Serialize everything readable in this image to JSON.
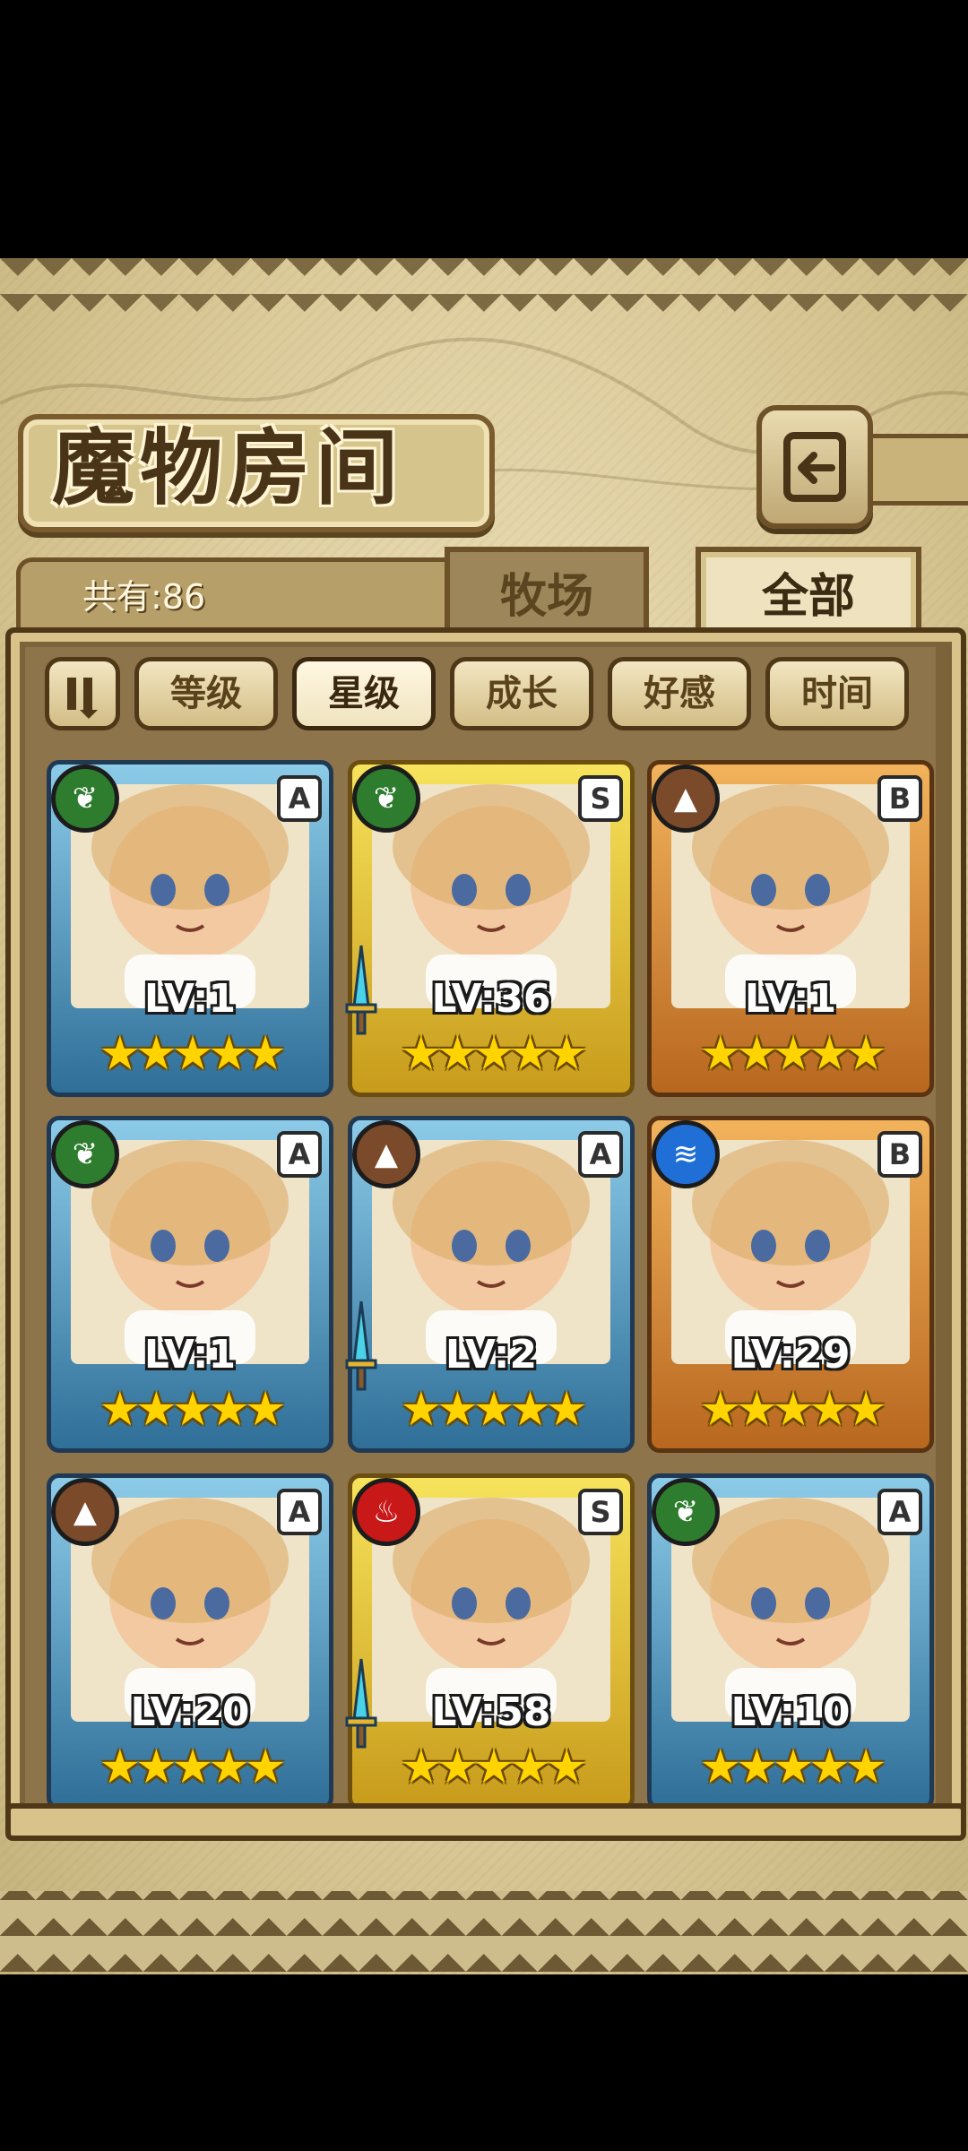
{
  "header": {
    "title": "魔物房间"
  },
  "summary": {
    "count_label": "共有:86"
  },
  "tabs": [
    {
      "label": "牧场",
      "active": false
    },
    {
      "label": "全部",
      "active": true
    }
  ],
  "sort": {
    "buttons": [
      {
        "label": "等级",
        "active": false
      },
      {
        "label": "星级",
        "active": true
      },
      {
        "label": "成长",
        "active": false
      },
      {
        "label": "好感",
        "active": false
      },
      {
        "label": "时间",
        "active": false
      }
    ]
  },
  "monsters": [
    {
      "level": "LV:1",
      "grade": "A",
      "element": "leaf",
      "stars": "★★★★★",
      "frame": "blue",
      "weapon": false
    },
    {
      "level": "LV:36",
      "grade": "S",
      "element": "leaf",
      "stars": "★★★★★",
      "frame": "gold",
      "weapon": true
    },
    {
      "level": "LV:1",
      "grade": "B",
      "element": "earth",
      "stars": "★★★★★",
      "frame": "orange",
      "weapon": false
    },
    {
      "level": "LV:1",
      "grade": "A",
      "element": "leaf",
      "stars": "★★★★★",
      "frame": "blue",
      "weapon": false
    },
    {
      "level": "LV:2",
      "grade": "A",
      "element": "earth",
      "stars": "★★★★★",
      "frame": "blue",
      "weapon": true
    },
    {
      "level": "LV:29",
      "grade": "B",
      "element": "water",
      "stars": "★★★★★",
      "frame": "orange",
      "weapon": false
    },
    {
      "level": "LV:20",
      "grade": "A",
      "element": "earth",
      "stars": "★★★★★",
      "frame": "blue",
      "weapon": false
    },
    {
      "level": "LV:58",
      "grade": "S",
      "element": "fire",
      "stars": "★★★★★",
      "frame": "gold",
      "weapon": true
    },
    {
      "level": "LV:10",
      "grade": "A",
      "element": "leaf",
      "stars": "★★★★★",
      "frame": "blue",
      "weapon": false
    }
  ],
  "colors": {
    "leaf": "#2e7d2e",
    "earth": "#7a4a2a",
    "water": "#1f6fd6",
    "fire": "#c81818"
  }
}
